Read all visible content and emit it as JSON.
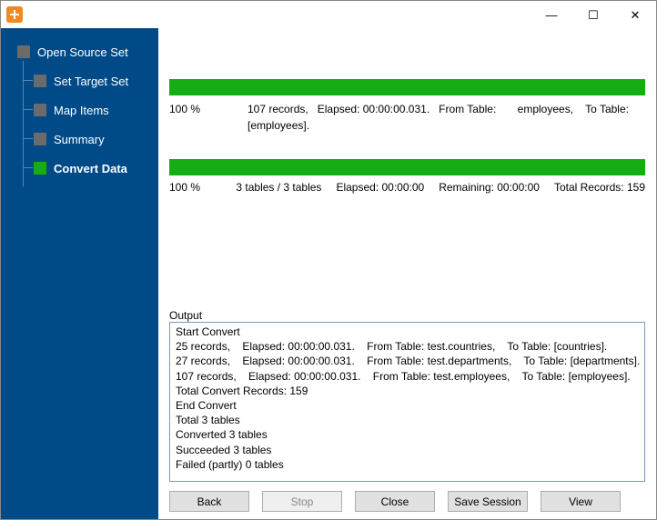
{
  "titlebar": {
    "app_title": ""
  },
  "win_controls": {
    "min": "—",
    "max": "☐",
    "close": "✕"
  },
  "sidebar": {
    "root": "Open Source Set",
    "children": [
      "Set Target Set",
      "Map Items",
      "Summary",
      "Convert Data"
    ],
    "active_index": 3
  },
  "progress1": {
    "percent_label": "100 %",
    "records": "107 records,",
    "elapsed": "Elapsed: 00:00:00.031.",
    "from_label": "From Table:",
    "from_value": "employees,",
    "to_label": "To Table:",
    "to_value": "[employees]."
  },
  "progress2": {
    "percent_label": "100 %",
    "tables": "3 tables / 3 tables",
    "elapsed": "Elapsed: 00:00:00",
    "remaining": "Remaining: 00:00:00",
    "total": "Total Records: 159"
  },
  "output": {
    "label": "Output",
    "lines": "Start Convert\n25 records,    Elapsed: 00:00:00.031.    From Table: test.countries,    To Table: [countries].\n27 records,    Elapsed: 00:00:00.031.    From Table: test.departments,    To Table: [departments].\n107 records,    Elapsed: 00:00:00.031.    From Table: test.employees,    To Table: [employees].\nTotal Convert Records: 159\nEnd Convert\nTotal 3 tables\nConverted 3 tables\nSucceeded 3 tables\nFailed (partly) 0 tables\n"
  },
  "footer": {
    "back": "Back",
    "stop": "Stop",
    "close": "Close",
    "save": "Save Session",
    "view": "View"
  }
}
